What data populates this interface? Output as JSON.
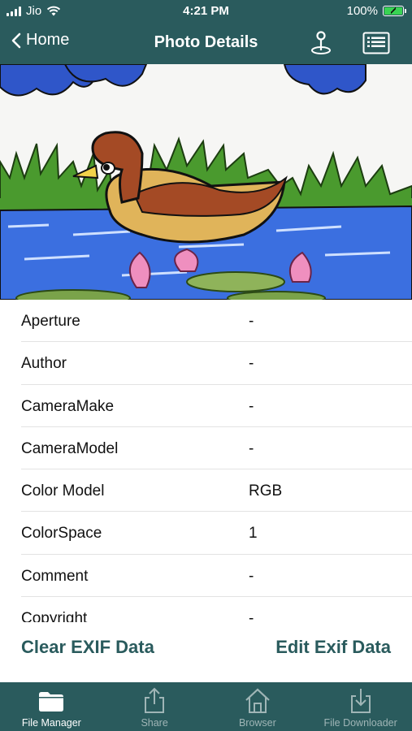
{
  "status_bar": {
    "carrier": "Jio",
    "time": "4:21 PM",
    "battery": "100%"
  },
  "nav": {
    "back_label": "Home",
    "title": "Photo Details",
    "location_icon": "map-pin-icon",
    "list_icon": "list-icon"
  },
  "colors": {
    "primary": "#2a5b5d",
    "tab_inactive": "#9fb5b6",
    "battery": "#39d353"
  },
  "details": [
    {
      "key": "Aperture",
      "value": "-"
    },
    {
      "key": "Author",
      "value": "-"
    },
    {
      "key": "CameraMake",
      "value": "-"
    },
    {
      "key": "CameraModel",
      "value": "-"
    },
    {
      "key": "Color Model",
      "value": "RGB"
    },
    {
      "key": "ColorSpace",
      "value": "1"
    },
    {
      "key": "Comment",
      "value": "-"
    },
    {
      "key": "Copyright",
      "value": "-"
    }
  ],
  "actions": {
    "clear_label": "Clear EXIF Data",
    "edit_label": "Edit Exif Data"
  },
  "tabs": [
    {
      "label": "File Manager",
      "icon": "folder-icon",
      "active": true
    },
    {
      "label": "Share",
      "icon": "share-icon",
      "active": false
    },
    {
      "label": "Browser",
      "icon": "home-icon",
      "active": false
    },
    {
      "label": "File Downloader",
      "icon": "download-icon",
      "active": false
    }
  ]
}
